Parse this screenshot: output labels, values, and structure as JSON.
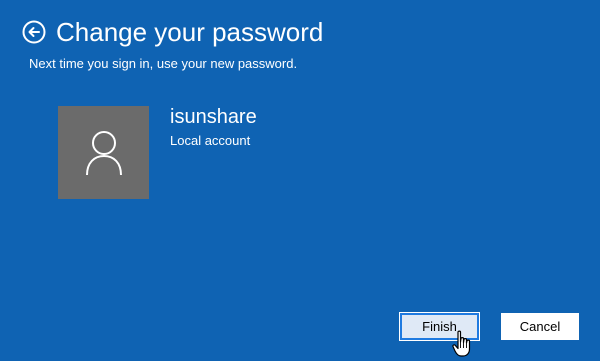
{
  "header": {
    "title": "Change your password",
    "subtitle": "Next time you sign in, use your new password."
  },
  "account": {
    "name": "isunshare",
    "type": "Local account"
  },
  "buttons": {
    "finish_label": "Finish",
    "cancel_label": "Cancel"
  },
  "icons": {
    "back": "back-arrow-circle-icon",
    "avatar": "user-silhouette-icon",
    "cursor": "hand-pointer-cursor"
  },
  "colors": {
    "background": "#0f63b3",
    "avatar_bg": "#6b6b6b",
    "button_bg": "#ffffff",
    "focus_border": "#1f7ae0"
  }
}
